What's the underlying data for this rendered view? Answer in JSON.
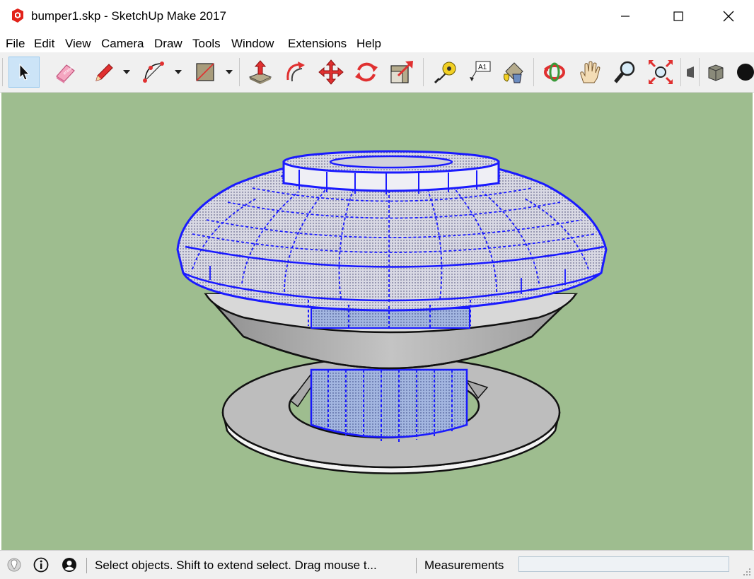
{
  "window": {
    "title": "bumper1.skp - SketchUp Make 2017"
  },
  "menu": {
    "items": [
      "File",
      "Edit",
      "View",
      "Camera",
      "Draw",
      "Tools",
      "Window",
      "Extensions",
      "Help"
    ]
  },
  "toolbar": {
    "tools": [
      {
        "name": "select-tool",
        "icon": "cursor-arrow-icon",
        "active": true
      },
      {
        "name": "eraser-tool",
        "icon": "eraser-icon"
      },
      {
        "name": "pencil-tool",
        "icon": "pencil-icon"
      },
      {
        "name": "arc-tool",
        "icon": "arc-icon"
      },
      {
        "name": "rectangle-tool",
        "icon": "rectangle-icon"
      },
      {
        "name": "push-pull-tool",
        "icon": "push-pull-icon"
      },
      {
        "name": "offset-tool",
        "icon": "offset-icon"
      },
      {
        "name": "move-tool",
        "icon": "move-arrows-icon"
      },
      {
        "name": "rotate-tool",
        "icon": "rotate-icon"
      },
      {
        "name": "scale-tool",
        "icon": "scale-icon"
      },
      {
        "name": "tape-measure-tool",
        "icon": "tape-measure-icon"
      },
      {
        "name": "text-tool",
        "icon": "text-label-icon"
      },
      {
        "name": "paint-bucket-tool",
        "icon": "paint-bucket-icon"
      },
      {
        "name": "orbit-tool",
        "icon": "orbit-icon"
      },
      {
        "name": "pan-tool",
        "icon": "hand-icon"
      },
      {
        "name": "zoom-tool",
        "icon": "magnifier-icon"
      },
      {
        "name": "zoom-extents-tool",
        "icon": "zoom-extents-icon"
      }
    ],
    "text_tool_label": "A1"
  },
  "viewport": {
    "background": "#9ebd8f",
    "selection_color": "#1a1aff"
  },
  "status": {
    "hint": "Select objects. Shift to extend select. Drag mouse t...",
    "measurements_label": "Measurements",
    "measurements_value": ""
  }
}
